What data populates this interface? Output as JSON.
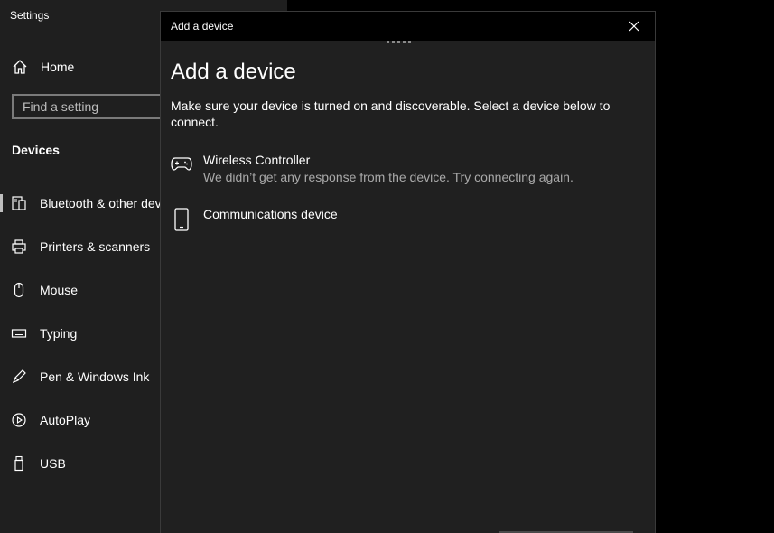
{
  "settings": {
    "title": "Settings",
    "home_label": "Home",
    "search_placeholder": "Find a setting",
    "section_title": "Devices",
    "nav": [
      {
        "label": "Bluetooth & other devices",
        "icon": "bluetooth-devices-icon"
      },
      {
        "label": "Printers & scanners",
        "icon": "printer-icon"
      },
      {
        "label": "Mouse",
        "icon": "mouse-icon"
      },
      {
        "label": "Typing",
        "icon": "keyboard-icon"
      },
      {
        "label": "Pen & Windows Ink",
        "icon": "pen-icon"
      },
      {
        "label": "AutoPlay",
        "icon": "autoplay-icon"
      },
      {
        "label": "USB",
        "icon": "usb-icon"
      }
    ]
  },
  "dialog": {
    "title": "Add a device",
    "heading": "Add a device",
    "description": "Make sure your device is turned on and discoverable. Select a device below to connect.",
    "devices": [
      {
        "name": "Wireless Controller",
        "status": "We didn’t get any response from the device. Try connecting again.",
        "icon": "gamepad-icon"
      },
      {
        "name": "Communications device",
        "status": "",
        "icon": "phone-icon"
      }
    ]
  },
  "colors": {
    "background": "#000000",
    "panel": "#1f1f1f",
    "dialog": "#202020",
    "secondary_text": "#a9a9a9"
  }
}
